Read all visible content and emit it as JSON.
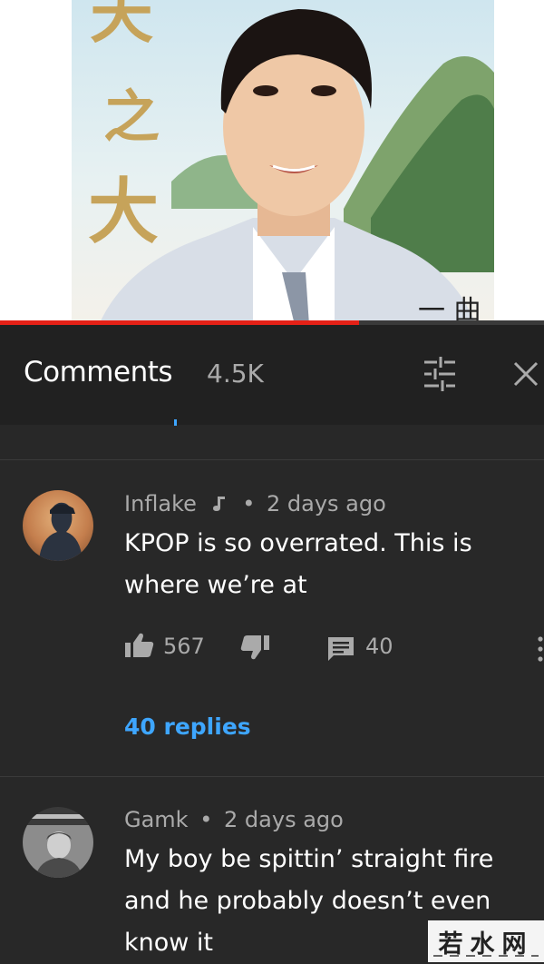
{
  "video": {
    "poster_glyphs": [
      "天",
      "之",
      "大"
    ],
    "poster_corner_glyph": "一 曲",
    "progress_fraction": 0.66,
    "accent_color": "#e52117"
  },
  "comments_panel": {
    "title": "Comments",
    "count": "4.5K",
    "sort_icon": "sort-filter-icon",
    "close_icon": "close-icon"
  },
  "comments": [
    {
      "author": "Inflake",
      "author_badge": "music-note-icon",
      "separator": "•",
      "time": "2 days ago",
      "text": "KPOP is so overrated. This is where we’re at",
      "likes": "567",
      "reply_count": "40",
      "replies_link": "40 replies"
    },
    {
      "author": "Gamk",
      "separator": "•",
      "time": "2 days ago",
      "text": "My boy be spittin’ straight fire and he probably doesn’t even know it"
    }
  ],
  "watermark": {
    "text": "若水网"
  },
  "colors": {
    "panel_bg": "#282828",
    "header_bg": "#212121",
    "link_blue": "#3ea6ff",
    "text_secondary": "#aaaaaa"
  }
}
